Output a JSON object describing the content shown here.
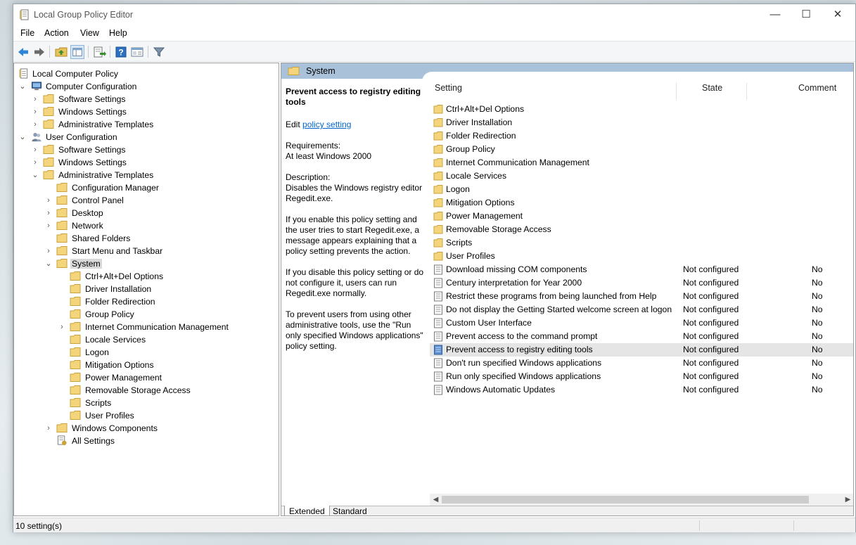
{
  "window": {
    "title": "Local Group Policy Editor",
    "minimize": "—",
    "maximize": "☐",
    "close": "✕"
  },
  "menu": [
    "File",
    "Action",
    "View",
    "Help"
  ],
  "toolbar_icons": [
    "back-arrow-icon",
    "forward-arrow-icon",
    "up-folder-icon",
    "show-hide-tree-icon",
    "export-list-icon",
    "help-icon",
    "properties-icon",
    "filter-icon"
  ],
  "tree": {
    "root": "Local Computer Policy",
    "computer_config": "Computer Configuration",
    "cc_software": "Software Settings",
    "cc_windows": "Windows Settings",
    "cc_admin": "Administrative Templates",
    "user_config": "User Configuration",
    "uc_software": "Software Settings",
    "uc_windows": "Windows Settings",
    "uc_admin": "Administrative Templates",
    "at_children": [
      "Configuration Manager",
      "Control Panel",
      "Desktop",
      "Network",
      "Shared Folders",
      "Start Menu and Taskbar",
      "System"
    ],
    "system_children": [
      "Ctrl+Alt+Del Options",
      "Driver Installation",
      "Folder Redirection",
      "Group Policy",
      "Internet Communication Management",
      "Locale Services",
      "Logon",
      "Mitigation Options",
      "Power Management",
      "Removable Storage Access",
      "Scripts",
      "User Profiles"
    ],
    "windows_components": "Windows Components",
    "all_settings": "All Settings"
  },
  "right": {
    "header": "System",
    "desc_title": "Prevent access to registry editing tools",
    "edit_prefix": "Edit ",
    "edit_link": "policy setting ",
    "req_label": "Requirements:",
    "req_value": "At least Windows 2000",
    "desc_label": "Description:",
    "desc_text": "Disables the Windows registry editor Regedit.exe.",
    "p1": "If you enable this policy setting and the user tries to start Regedit.exe, a message appears explaining that a policy setting prevents the action.",
    "p2": "If you disable this policy setting or do not configure it, users can run Regedit.exe normally.",
    "p3": "To prevent users from using other administrative tools, use the \"Run only specified Windows applications\" policy setting.",
    "columns": {
      "setting": "Setting",
      "state": "State",
      "comment": "Comment"
    },
    "folders": [
      "Ctrl+Alt+Del Options",
      "Driver Installation",
      "Folder Redirection",
      "Group Policy",
      "Internet Communication Management",
      "Locale Services",
      "Logon",
      "Mitigation Options",
      "Power Management",
      "Removable Storage Access",
      "Scripts",
      "User Profiles"
    ],
    "settings": [
      {
        "name": "Download missing COM components",
        "state": "Not configured",
        "comment": "No"
      },
      {
        "name": "Century interpretation for Year 2000",
        "state": "Not configured",
        "comment": "No"
      },
      {
        "name": "Restrict these programs from being launched from Help",
        "state": "Not configured",
        "comment": "No"
      },
      {
        "name": "Do not display the Getting Started welcome screen at logon",
        "state": "Not configured",
        "comment": "No"
      },
      {
        "name": "Custom User Interface",
        "state": "Not configured",
        "comment": "No"
      },
      {
        "name": "Prevent access to the command prompt",
        "state": "Not configured",
        "comment": "No"
      },
      {
        "name": "Prevent access to registry editing tools",
        "state": "Not configured",
        "comment": "No",
        "selected": true
      },
      {
        "name": "Don't run specified Windows applications",
        "state": "Not configured",
        "comment": "No"
      },
      {
        "name": "Run only specified Windows applications",
        "state": "Not configured",
        "comment": "No"
      },
      {
        "name": "Windows Automatic Updates",
        "state": "Not configured",
        "comment": "No"
      }
    ],
    "tabs": [
      "Extended",
      "Standard"
    ]
  },
  "status": "10 setting(s)"
}
